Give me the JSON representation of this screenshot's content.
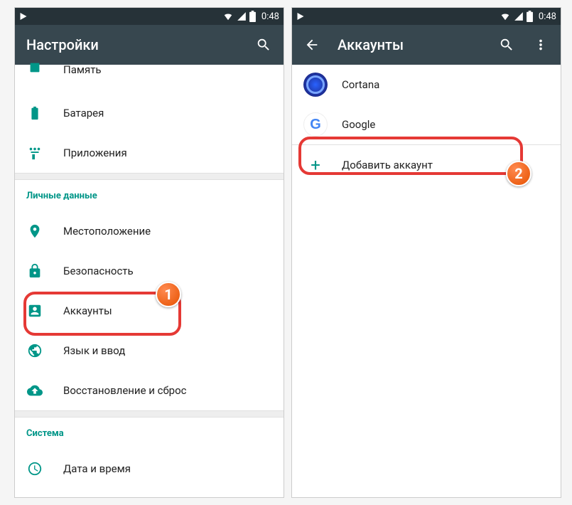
{
  "statusbar": {
    "time": "0:48"
  },
  "left": {
    "title": "Настройки",
    "items": {
      "memory": "Память",
      "battery": "Батарея",
      "apps": "Приложения",
      "section_personal": "Личные данные",
      "location": "Местоположение",
      "security": "Безопасность",
      "accounts": "Аккаунты",
      "language": "Язык и ввод",
      "backup": "Восстановление и сброс",
      "section_system": "Система",
      "datetime": "Дата и время"
    }
  },
  "right": {
    "title": "Аккаунты",
    "items": {
      "cortana": "Cortana",
      "google": "Google",
      "add": "Добавить аккаунт"
    }
  },
  "annotations": {
    "step1": "1",
    "step2": "2"
  }
}
